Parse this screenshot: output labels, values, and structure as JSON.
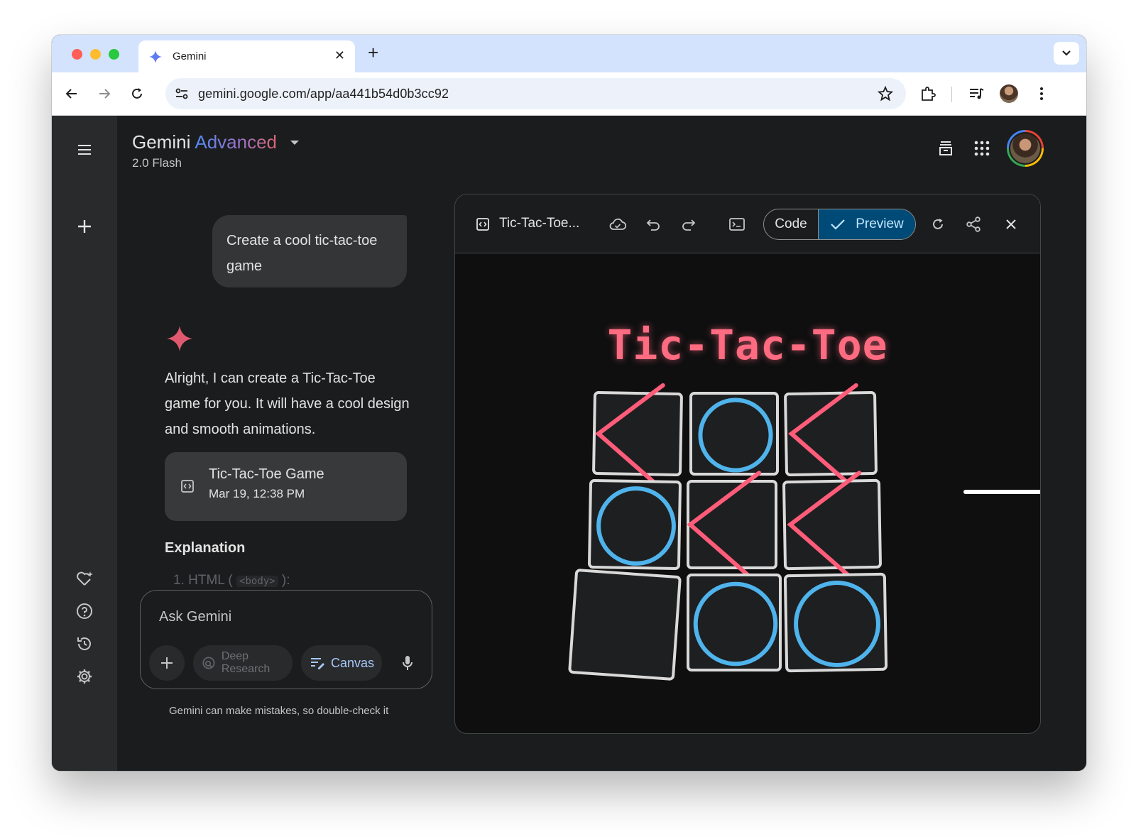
{
  "browser": {
    "tab_title": "Gemini",
    "url": "gemini.google.com/app/aa441b54d0b3cc92"
  },
  "header": {
    "brand": "Gemini",
    "tier": "Advanced",
    "model": "2.0 Flash"
  },
  "chat": {
    "user_message": "Create a cool tic-tac-toe game",
    "reply_text": "Alright, I can create a Tic-Tac-Toe game for you. It will have a cool design and smooth animations.",
    "doc_card": {
      "title": "Tic-Tac-Toe Game",
      "date": "Mar 19, 12:38 PM"
    },
    "section_heading": "Explanation",
    "list_item_prefix": "1.  HTML (",
    "list_item_code": "<body>",
    "list_item_suffix": "):"
  },
  "composer": {
    "placeholder": "Ask Gemini",
    "deep_research_label": "Deep Research",
    "canvas_label": "Canvas",
    "disclaimer": "Gemini can make mistakes, so double-check it"
  },
  "canvas_panel": {
    "title": "Tic-Tac-Toe...",
    "code_label": "Code",
    "preview_label": "Preview",
    "mode": "preview"
  },
  "game": {
    "title": "Tic-Tac-Toe",
    "board": [
      [
        "X",
        "O",
        "X"
      ],
      [
        "O",
        "X",
        "X"
      ],
      [
        "",
        "O",
        "O"
      ]
    ]
  },
  "colors": {
    "x_mark": "#ff5c7a",
    "o_mark": "#4fb3ec",
    "accent_preview": "#004a77",
    "tab_strip": "#d3e3fd"
  },
  "icons": {
    "rail": [
      "menu-icon",
      "new-chat-icon",
      "gem-icon",
      "help-icon",
      "activity-icon",
      "settings-icon"
    ],
    "panel": [
      "code-icon",
      "cloud-icon",
      "undo-icon",
      "redo-icon",
      "console-icon",
      "refresh-icon",
      "share-icon",
      "close-icon"
    ]
  }
}
